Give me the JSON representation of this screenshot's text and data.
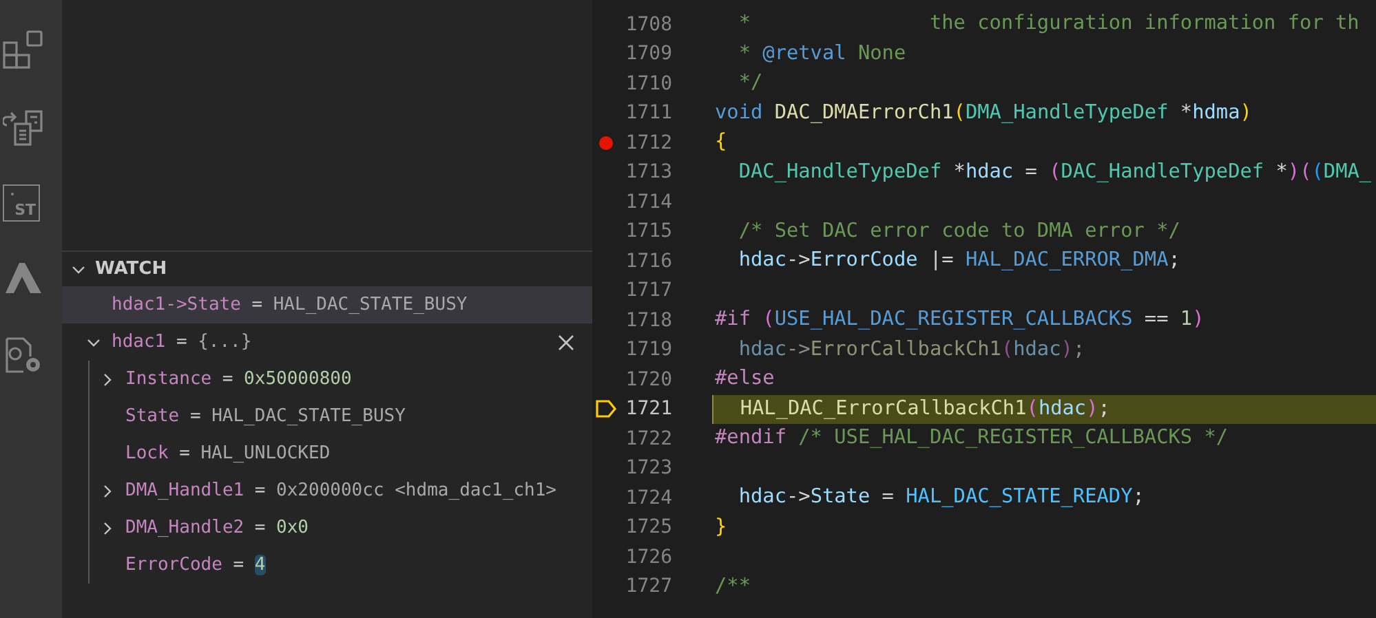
{
  "activity_bar": [
    {
      "kind": "extensions"
    },
    {
      "kind": "files"
    },
    {
      "kind": "board",
      "label": "ST"
    },
    {
      "kind": "peak"
    },
    {
      "kind": "file-settings"
    }
  ],
  "watch": {
    "title": "WATCH",
    "expanded": true,
    "items": [
      {
        "name": "hdac1->State",
        "operator": "=",
        "value": "HAL_DAC_STATE_BUSY",
        "kind": "text",
        "selected": true
      },
      {
        "name": "hdac1",
        "operator": "=",
        "value": "{...}",
        "kind": "text",
        "selected": false,
        "hovered": true,
        "expanded": true,
        "children": [
          {
            "name": "Instance",
            "operator": "=",
            "value": "0x50000800",
            "kind": "number",
            "expanded": false
          },
          {
            "name": "State",
            "operator": "=",
            "value": "HAL_DAC_STATE_BUSY",
            "kind": "text"
          },
          {
            "name": "Lock",
            "operator": "=",
            "value": "HAL_UNLOCKED",
            "kind": "text"
          },
          {
            "name": "DMA_Handle1",
            "operator": "=",
            "value": "0x200000cc <hdma_dac1_ch1>",
            "kind": "text",
            "expanded": false
          },
          {
            "name": "DMA_Handle2",
            "operator": "=",
            "value": "0x0",
            "kind": "number",
            "expanded": false
          },
          {
            "name": "ErrorCode",
            "operator": "=",
            "value": "4",
            "kind": "number",
            "changed": true
          }
        ]
      }
    ]
  },
  "editor": {
    "lines": [
      {
        "number": "1708",
        "tokens": [
          {
            "kind": "comment",
            "text": "  *               the configuration information for th"
          }
        ]
      },
      {
        "number": "1709",
        "tokens": [
          {
            "kind": "comment",
            "text": "  * "
          },
          {
            "kind": "doctag",
            "text": "@retval"
          },
          {
            "kind": "comment",
            "text": " None"
          }
        ]
      },
      {
        "number": "1710",
        "tokens": [
          {
            "kind": "comment",
            "text": "  */"
          }
        ]
      },
      {
        "number": "1711",
        "tokens": [
          {
            "kind": "keyword",
            "text": "void "
          },
          {
            "kind": "function",
            "text": "DAC_DMAErrorCh1"
          },
          {
            "kind": "bracket1",
            "text": "("
          },
          {
            "kind": "type",
            "text": "DMA_HandleTypeDef"
          },
          {
            "kind": "plain",
            "text": " *"
          },
          {
            "kind": "variable",
            "text": "hdma"
          },
          {
            "kind": "bracket1",
            "text": ")"
          }
        ]
      },
      {
        "number": "1712",
        "breakpoint": true,
        "tokens": [
          {
            "kind": "bracket1",
            "text": "{"
          }
        ]
      },
      {
        "number": "1713",
        "tokens": [
          {
            "kind": "type",
            "text": "  DAC_HandleTypeDef"
          },
          {
            "kind": "plain",
            "text": " *"
          },
          {
            "kind": "variable",
            "text": "hdac"
          },
          {
            "kind": "plain",
            "text": " = "
          },
          {
            "kind": "bracket2",
            "text": "("
          },
          {
            "kind": "type",
            "text": "DAC_HandleTypeDef"
          },
          {
            "kind": "plain",
            "text": " *"
          },
          {
            "kind": "bracket2",
            "text": ")("
          },
          {
            "kind": "bracket3",
            "text": "("
          },
          {
            "kind": "type",
            "text": "DMA_"
          }
        ]
      },
      {
        "number": "1714"
      },
      {
        "number": "1715",
        "tokens": [
          {
            "kind": "comment",
            "text": "  /* Set DAC error code to DMA error */"
          }
        ]
      },
      {
        "number": "1716",
        "tokens": [
          {
            "kind": "variable",
            "text": "  hdac"
          },
          {
            "kind": "plain",
            "text": "->"
          },
          {
            "kind": "variable",
            "text": "ErrorCode"
          },
          {
            "kind": "plain",
            "text": " |= "
          },
          {
            "kind": "macro",
            "text": "HAL_DAC_ERROR_DMA"
          },
          {
            "kind": "plain",
            "text": ";"
          }
        ]
      },
      {
        "number": "1717"
      },
      {
        "number": "1718",
        "tokens": [
          {
            "kind": "preproc",
            "text": "#if "
          },
          {
            "kind": "bracket2",
            "text": "("
          },
          {
            "kind": "macro",
            "text": "USE_HAL_DAC_REGISTER_CALLBACKS"
          },
          {
            "kind": "plain",
            "text": " == "
          },
          {
            "kind": "number",
            "text": "1"
          },
          {
            "kind": "bracket2",
            "text": ")"
          }
        ]
      },
      {
        "number": "1719",
        "dimmed": true,
        "tokens": [
          {
            "kind": "variable",
            "text": "  hdac"
          },
          {
            "kind": "plain",
            "text": "->"
          },
          {
            "kind": "function",
            "text": "ErrorCallbackCh1"
          },
          {
            "kind": "bracket2",
            "text": "("
          },
          {
            "kind": "variable",
            "text": "hdac"
          },
          {
            "kind": "bracket2",
            "text": ")"
          },
          {
            "kind": "plain",
            "text": ";"
          }
        ]
      },
      {
        "number": "1720",
        "tokens": [
          {
            "kind": "preproc",
            "text": "#else"
          }
        ]
      },
      {
        "number": "1721",
        "current": true,
        "tokens": [
          {
            "kind": "function",
            "text": "  HAL_DAC_ErrorCallbackCh1"
          },
          {
            "kind": "bracket2",
            "text": "("
          },
          {
            "kind": "variable",
            "text": "hdac"
          },
          {
            "kind": "bracket2",
            "text": ")"
          },
          {
            "kind": "plain",
            "text": ";"
          }
        ]
      },
      {
        "number": "1722",
        "tokens": [
          {
            "kind": "preproc",
            "text": "#endif"
          },
          {
            "kind": "comment",
            "text": " /* USE_HAL_DAC_REGISTER_CALLBACKS */"
          }
        ]
      },
      {
        "number": "1723"
      },
      {
        "number": "1724",
        "tokens": [
          {
            "kind": "variable",
            "text": "  hdac"
          },
          {
            "kind": "plain",
            "text": "->"
          },
          {
            "kind": "variable",
            "text": "State"
          },
          {
            "kind": "plain",
            "text": " = "
          },
          {
            "kind": "constant",
            "text": "HAL_DAC_STATE_READY"
          },
          {
            "kind": "plain",
            "text": ";"
          }
        ]
      },
      {
        "number": "1725",
        "tokens": [
          {
            "kind": "bracket1",
            "text": "}"
          }
        ]
      },
      {
        "number": "1726"
      },
      {
        "number": "1727",
        "tokens": [
          {
            "kind": "comment",
            "text": "/**"
          }
        ]
      }
    ]
  }
}
